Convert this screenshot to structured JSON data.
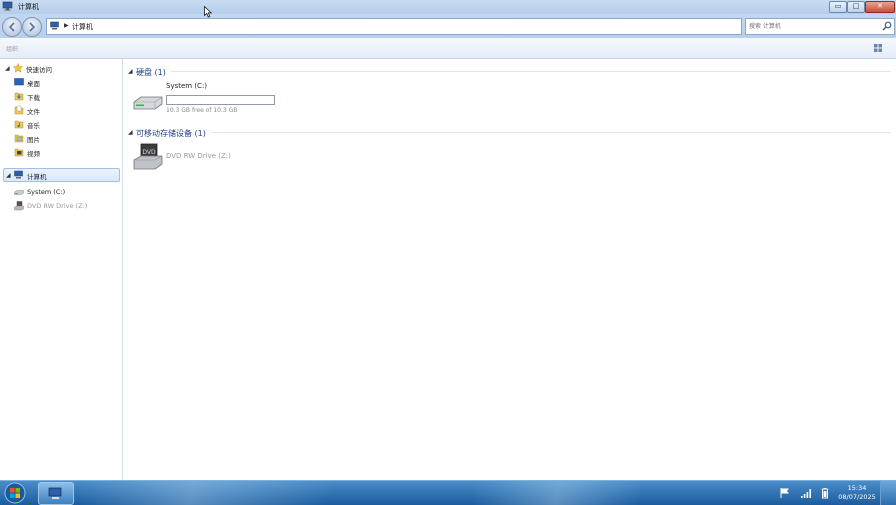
{
  "window": {
    "title": "计算机",
    "buttons": {
      "minimize": "▭",
      "maximize": "□",
      "close": "✕"
    }
  },
  "address": {
    "arrow": "▶",
    "path": "计算机",
    "search_placeholder": "搜索 计算机"
  },
  "toolbar": {
    "organize_label": "组织"
  },
  "sidebar": {
    "quick_access": {
      "label": "快速访问",
      "items": [
        "桌面",
        "下载",
        "文件",
        "音乐",
        "图片",
        "视频"
      ]
    },
    "computer": {
      "label": "计算机",
      "items": [
        "System (C:)",
        "DVD RW Drive (Z:)"
      ]
    }
  },
  "content": {
    "hard_disks": {
      "heading": "硬盘 (1)",
      "drive_name": "System (C:)",
      "free_text": "10.3 GB free of 10.3 GB",
      "used_fraction": 0.0
    },
    "removable": {
      "heading": "可移动存储设备 (1)",
      "drive_name": "DVD RW Drive (Z:)"
    }
  },
  "taskbar": {
    "time": "15:34",
    "date": "08/07/2025"
  }
}
